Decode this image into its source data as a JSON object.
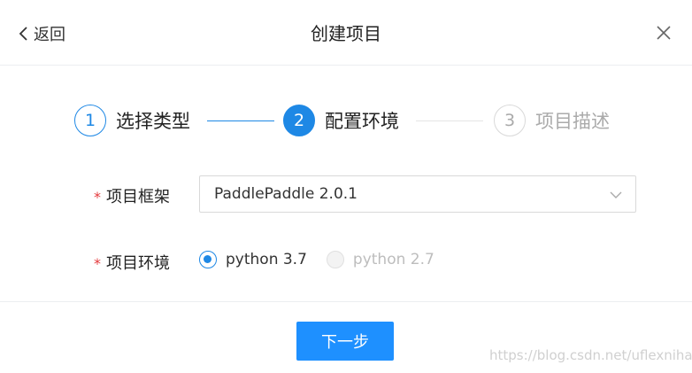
{
  "header": {
    "back_label": "返回",
    "title": "创建项目"
  },
  "steps": [
    {
      "number": "1",
      "label": "选择类型",
      "state": "done"
    },
    {
      "number": "2",
      "label": "配置环境",
      "state": "active"
    },
    {
      "number": "3",
      "label": "项目描述",
      "state": "waiting"
    }
  ],
  "form": {
    "required_mark": "*",
    "framework": {
      "label": "项目框架",
      "value": "PaddlePaddle 2.0.1"
    },
    "environment": {
      "label": "项目环境",
      "options": [
        {
          "label": "python 3.7",
          "selected": true,
          "disabled": false
        },
        {
          "label": "python 2.7",
          "selected": false,
          "disabled": true
        }
      ]
    }
  },
  "footer": {
    "next_label": "下一步"
  },
  "watermark": "https://blog.csdn.net/uflexnihao",
  "colors": {
    "primary": "#1e88e5",
    "button": "#1e90ff",
    "required": "#e4393c",
    "disabled_text": "#bdbdbd"
  },
  "icons": {
    "back": "chevron-left-icon",
    "close": "close-icon",
    "dropdown": "chevron-down-icon"
  }
}
